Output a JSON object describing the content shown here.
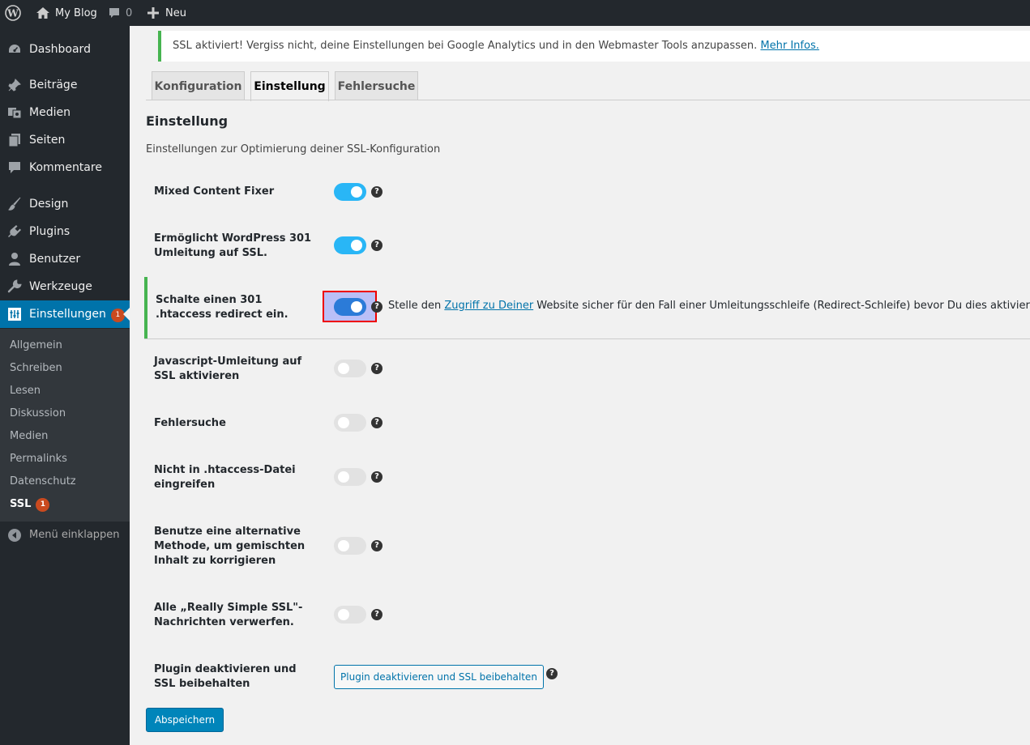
{
  "adminbar": {
    "site_name": "My Blog",
    "comments_count": "0",
    "new_label": "Neu"
  },
  "sidebar": {
    "items": [
      {
        "label": "Dashboard",
        "icon": "dashboard-icon"
      },
      {
        "label": "Beiträge",
        "icon": "pin-icon"
      },
      {
        "label": "Medien",
        "icon": "media-icon"
      },
      {
        "label": "Seiten",
        "icon": "pages-icon"
      },
      {
        "label": "Kommentare",
        "icon": "comment-icon"
      },
      {
        "label": "Design",
        "icon": "brush-icon"
      },
      {
        "label": "Plugins",
        "icon": "plugin-icon"
      },
      {
        "label": "Benutzer",
        "icon": "user-icon"
      },
      {
        "label": "Werkzeuge",
        "icon": "wrench-icon"
      },
      {
        "label": "Einstellungen",
        "icon": "settings-icon",
        "badge": "1",
        "current": true
      }
    ],
    "submenu": [
      {
        "label": "Allgemein"
      },
      {
        "label": "Schreiben"
      },
      {
        "label": "Lesen"
      },
      {
        "label": "Diskussion"
      },
      {
        "label": "Medien"
      },
      {
        "label": "Permalinks"
      },
      {
        "label": "Datenschutz"
      },
      {
        "label": "SSL",
        "badge": "1",
        "current": true
      }
    ],
    "collapse_label": "Menü einklappen"
  },
  "notice": {
    "text": "SSL aktiviert! Vergiss nicht, deine Einstellungen bei Google Analytics und in den Webmaster Tools anzupassen.",
    "link": "Mehr Infos."
  },
  "tabs": [
    {
      "label": "Konfiguration",
      "active": false
    },
    {
      "label": "Einstellung",
      "active": true
    },
    {
      "label": "Fehlersuche",
      "active": false
    }
  ],
  "section": {
    "title": "Einstellung",
    "description": "Einstellungen zur Optimierung deiner SSL-Konfiguration"
  },
  "settings": [
    {
      "label": "Mixed Content Fixer",
      "enabled": true
    },
    {
      "label": "Ermöglicht WordPress 301 Umleitung auf SSL.",
      "enabled": true
    },
    {
      "label": "Schalte einen 301 .htaccess redirect ein.",
      "enabled": true
    },
    {
      "label": "Javascript-Umleitung auf SSL aktivieren",
      "enabled": false
    },
    {
      "label": "Fehlersuche",
      "enabled": false
    },
    {
      "label": "Nicht in .htaccess-Datei eingreifen",
      "enabled": false
    },
    {
      "label": "Benutze eine alternative Methode, um gemischten Inhalt zu korrigieren",
      "enabled": false
    },
    {
      "label": "Alle „Really Simple SSL\"-Nachrichten verwerfen.",
      "enabled": false
    },
    {
      "label": "Plugin deaktivieren und SSL beibehalten"
    }
  ],
  "htaccess_note": {
    "before": "Stelle den ",
    "link": "Zugriff zu Deiner",
    "after": " Website sicher für den Fall einer Umleitungsschleife (Redirect-Schleife) bevor Du dies aktivierst."
  },
  "help_glyph": "?",
  "buttons": {
    "deactivate": "Plugin deaktivieren und SSL beibehalten",
    "save": "Abspeichern"
  },
  "colors": {
    "accent": "#0073aa",
    "toggle_on": "#29b6f6",
    "notice_border": "#46b450",
    "badge": "#ca4a1f"
  }
}
